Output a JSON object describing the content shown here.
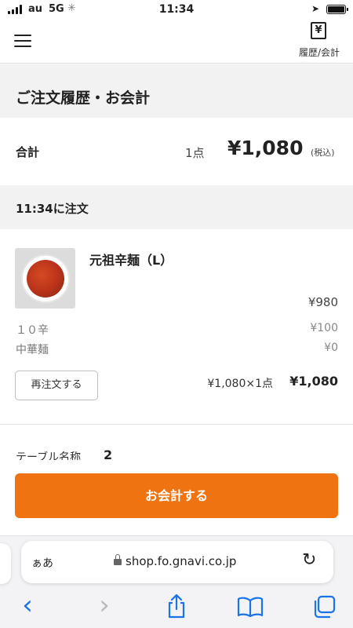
{
  "status_bar": {
    "carrier": "au",
    "network": "5G",
    "time": "11:34"
  },
  "header": {
    "menu_icon": "hamburger-icon",
    "history_icon": "receipt-yen-icon",
    "history_icon_glyph": "¥",
    "history_label": "履歴/会計"
  },
  "page": {
    "title": "ご注文履歴・お会計"
  },
  "total": {
    "label": "合計",
    "count": "1点",
    "amount": "¥1,080",
    "tax_note": "(税込)"
  },
  "order": {
    "time_heading": "11:34に注文",
    "item": {
      "name": "元祖辛麺（L）",
      "price": "¥980",
      "options": [
        {
          "name": "１０辛",
          "price": "¥100"
        },
        {
          "name": "中華麺",
          "price": "¥0"
        }
      ],
      "reorder_label": "再注文する",
      "line_calc": "¥1,080×1点",
      "line_total": "¥1,080"
    },
    "table_label": "テーブル名称",
    "table_value": "2"
  },
  "checkout": {
    "label": "お会計する",
    "color": "#f07312"
  },
  "browser": {
    "text_size_label": "ぁあ",
    "url": "shop.fo.gnavi.co.jp",
    "accent_color": "#1a73e8",
    "toolbar": {
      "back": "‹",
      "forward": "›"
    }
  }
}
